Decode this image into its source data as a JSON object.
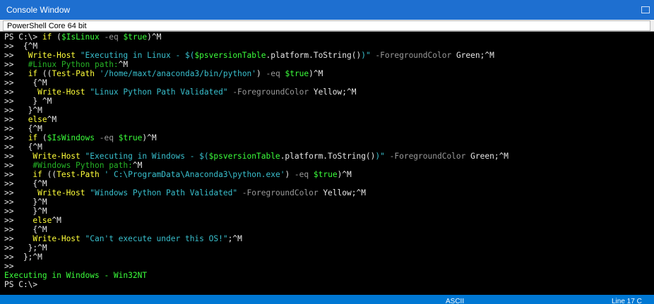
{
  "window": {
    "title": "Console Window"
  },
  "tab": {
    "label": "PowerShell Core 64 bit"
  },
  "console": {
    "lines": [
      [
        [
          "PS C:\\> ",
          "def"
        ],
        [
          "if ",
          "kw"
        ],
        [
          "(",
          "def"
        ],
        [
          "$IsLinux",
          "var"
        ],
        [
          " -eq ",
          "param"
        ],
        [
          "$true",
          "var"
        ],
        [
          ")^M",
          "def"
        ]
      ],
      [
        [
          ">>  {^M",
          "def"
        ]
      ],
      [
        [
          ">>   ",
          "def"
        ],
        [
          "Write-Host ",
          "kw"
        ],
        [
          "\"Executing in Linux - $(",
          "str"
        ],
        [
          "$psversionTable",
          "var"
        ],
        [
          ".platform.ToString()",
          "def"
        ],
        [
          ")\"",
          "str"
        ],
        [
          " -ForegroundColor ",
          "param"
        ],
        [
          "Green",
          "def"
        ],
        [
          ";^M",
          "def"
        ]
      ],
      [
        [
          ">>   ",
          "def"
        ],
        [
          "#Linux Python path:",
          "com"
        ],
        [
          "^M",
          "def"
        ]
      ],
      [
        [
          ">>   ",
          "def"
        ],
        [
          "if ",
          "kw"
        ],
        [
          "((",
          "def"
        ],
        [
          "Test-Path ",
          "kw"
        ],
        [
          "'/home/maxt/anaconda3/bin/python'",
          "str"
        ],
        [
          ") ",
          "def"
        ],
        [
          "-eq ",
          "param"
        ],
        [
          "$true",
          "var"
        ],
        [
          ")^M",
          "def"
        ]
      ],
      [
        [
          ">>    {^M",
          "def"
        ]
      ],
      [
        [
          ">>     ",
          "def"
        ],
        [
          "Write-Host ",
          "kw"
        ],
        [
          "\"Linux Python Path Validated\"",
          "str"
        ],
        [
          " -ForegroundColor ",
          "param"
        ],
        [
          "Yellow",
          "def"
        ],
        [
          ";^M",
          "def"
        ]
      ],
      [
        [
          ">>    } ^M",
          "def"
        ]
      ],
      [
        [
          ">>   }^M",
          "def"
        ]
      ],
      [
        [
          ">>   ",
          "def"
        ],
        [
          "else",
          "kw"
        ],
        [
          "^M",
          "def"
        ]
      ],
      [
        [
          ">>   {^M",
          "def"
        ]
      ],
      [
        [
          ">>   ",
          "def"
        ],
        [
          "if ",
          "kw"
        ],
        [
          "(",
          "def"
        ],
        [
          "$IsWindows",
          "var"
        ],
        [
          " -eq ",
          "param"
        ],
        [
          "$true",
          "var"
        ],
        [
          ")^M",
          "def"
        ]
      ],
      [
        [
          ">>   {^M",
          "def"
        ]
      ],
      [
        [
          ">>    ",
          "def"
        ],
        [
          "Write-Host ",
          "kw"
        ],
        [
          "\"Executing in Windows - $(",
          "str"
        ],
        [
          "$psversionTable",
          "var"
        ],
        [
          ".platform.ToString()",
          "def"
        ],
        [
          ")\"",
          "str"
        ],
        [
          " -ForegroundColor ",
          "param"
        ],
        [
          "Green",
          "def"
        ],
        [
          ";^M",
          "def"
        ]
      ],
      [
        [
          ">>    ",
          "def"
        ],
        [
          "#Windows Python path:",
          "com"
        ],
        [
          "^M",
          "def"
        ]
      ],
      [
        [
          ">>    ",
          "def"
        ],
        [
          "if ",
          "kw"
        ],
        [
          "((",
          "def"
        ],
        [
          "Test-Path ",
          "kw"
        ],
        [
          "' C:\\ProgramData\\Anaconda3\\python.exe'",
          "str"
        ],
        [
          ") ",
          "def"
        ],
        [
          "-eq ",
          "param"
        ],
        [
          "$true",
          "var"
        ],
        [
          ")^M",
          "def"
        ]
      ],
      [
        [
          ">>    {^M",
          "def"
        ]
      ],
      [
        [
          ">>     ",
          "def"
        ],
        [
          "Write-Host ",
          "kw"
        ],
        [
          "\"Windows Python Path Validated\"",
          "str"
        ],
        [
          " -ForegroundColor ",
          "param"
        ],
        [
          "Yellow",
          "def"
        ],
        [
          ";^M",
          "def"
        ]
      ],
      [
        [
          ">>    }^M",
          "def"
        ]
      ],
      [
        [
          ">>    }^M",
          "def"
        ]
      ],
      [
        [
          ">>    ",
          "def"
        ],
        [
          "else",
          "kw"
        ],
        [
          "^M",
          "def"
        ]
      ],
      [
        [
          ">>    {^M",
          "def"
        ]
      ],
      [
        [
          ">>    ",
          "def"
        ],
        [
          "Write-Host ",
          "kw"
        ],
        [
          "\"Can't execute under this OS!\"",
          "str"
        ],
        [
          ";^M",
          "def"
        ]
      ],
      [
        [
          ">>   };^M",
          "def"
        ]
      ],
      [
        [
          ">>  };^M",
          "def"
        ]
      ],
      [
        [
          ">>",
          "def"
        ]
      ],
      [
        [
          "Executing in Windows - Win32NT",
          "out"
        ]
      ],
      [
        [
          "PS C:\\>",
          "def"
        ]
      ]
    ]
  },
  "status": {
    "encoding": "ASCII",
    "line_label": "Line  17  C"
  },
  "colors": {
    "keyword": "#ffff3a",
    "variable": "#3bff3b",
    "string": "#39c0ce",
    "comment": "#26b526",
    "parameter": "#9a9a9a",
    "default": "#e6e6e6",
    "titlebar": "#1e6fd0",
    "statusbar": "#0078d4"
  }
}
